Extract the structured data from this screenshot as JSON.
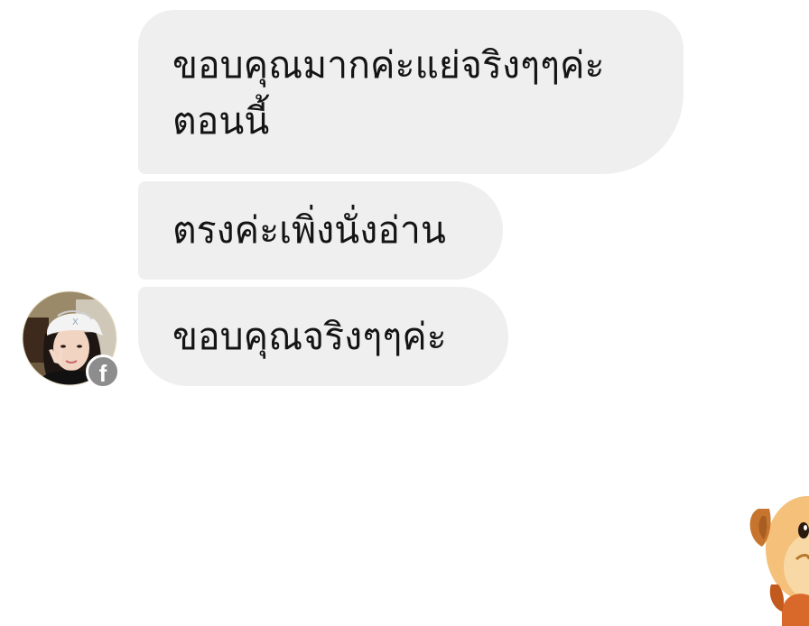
{
  "conversation": {
    "messages": [
      {
        "lines": [
          "ขอบคุณมากค่ะแย่จริงๆๆค่ะ",
          "ตอนนี้"
        ]
      },
      {
        "lines": [
          "ตรงค่ะเพิ่งนั่งอ่าน"
        ]
      },
      {
        "lines": [
          "ขอบคุณจริงๆๆค่ะ"
        ]
      }
    ],
    "sender": {
      "platform_badge": "f",
      "platform_icon": "facebook-icon"
    }
  },
  "colors": {
    "bubble": "#efefef",
    "text": "#141414",
    "badge": "#8d8d8d"
  }
}
